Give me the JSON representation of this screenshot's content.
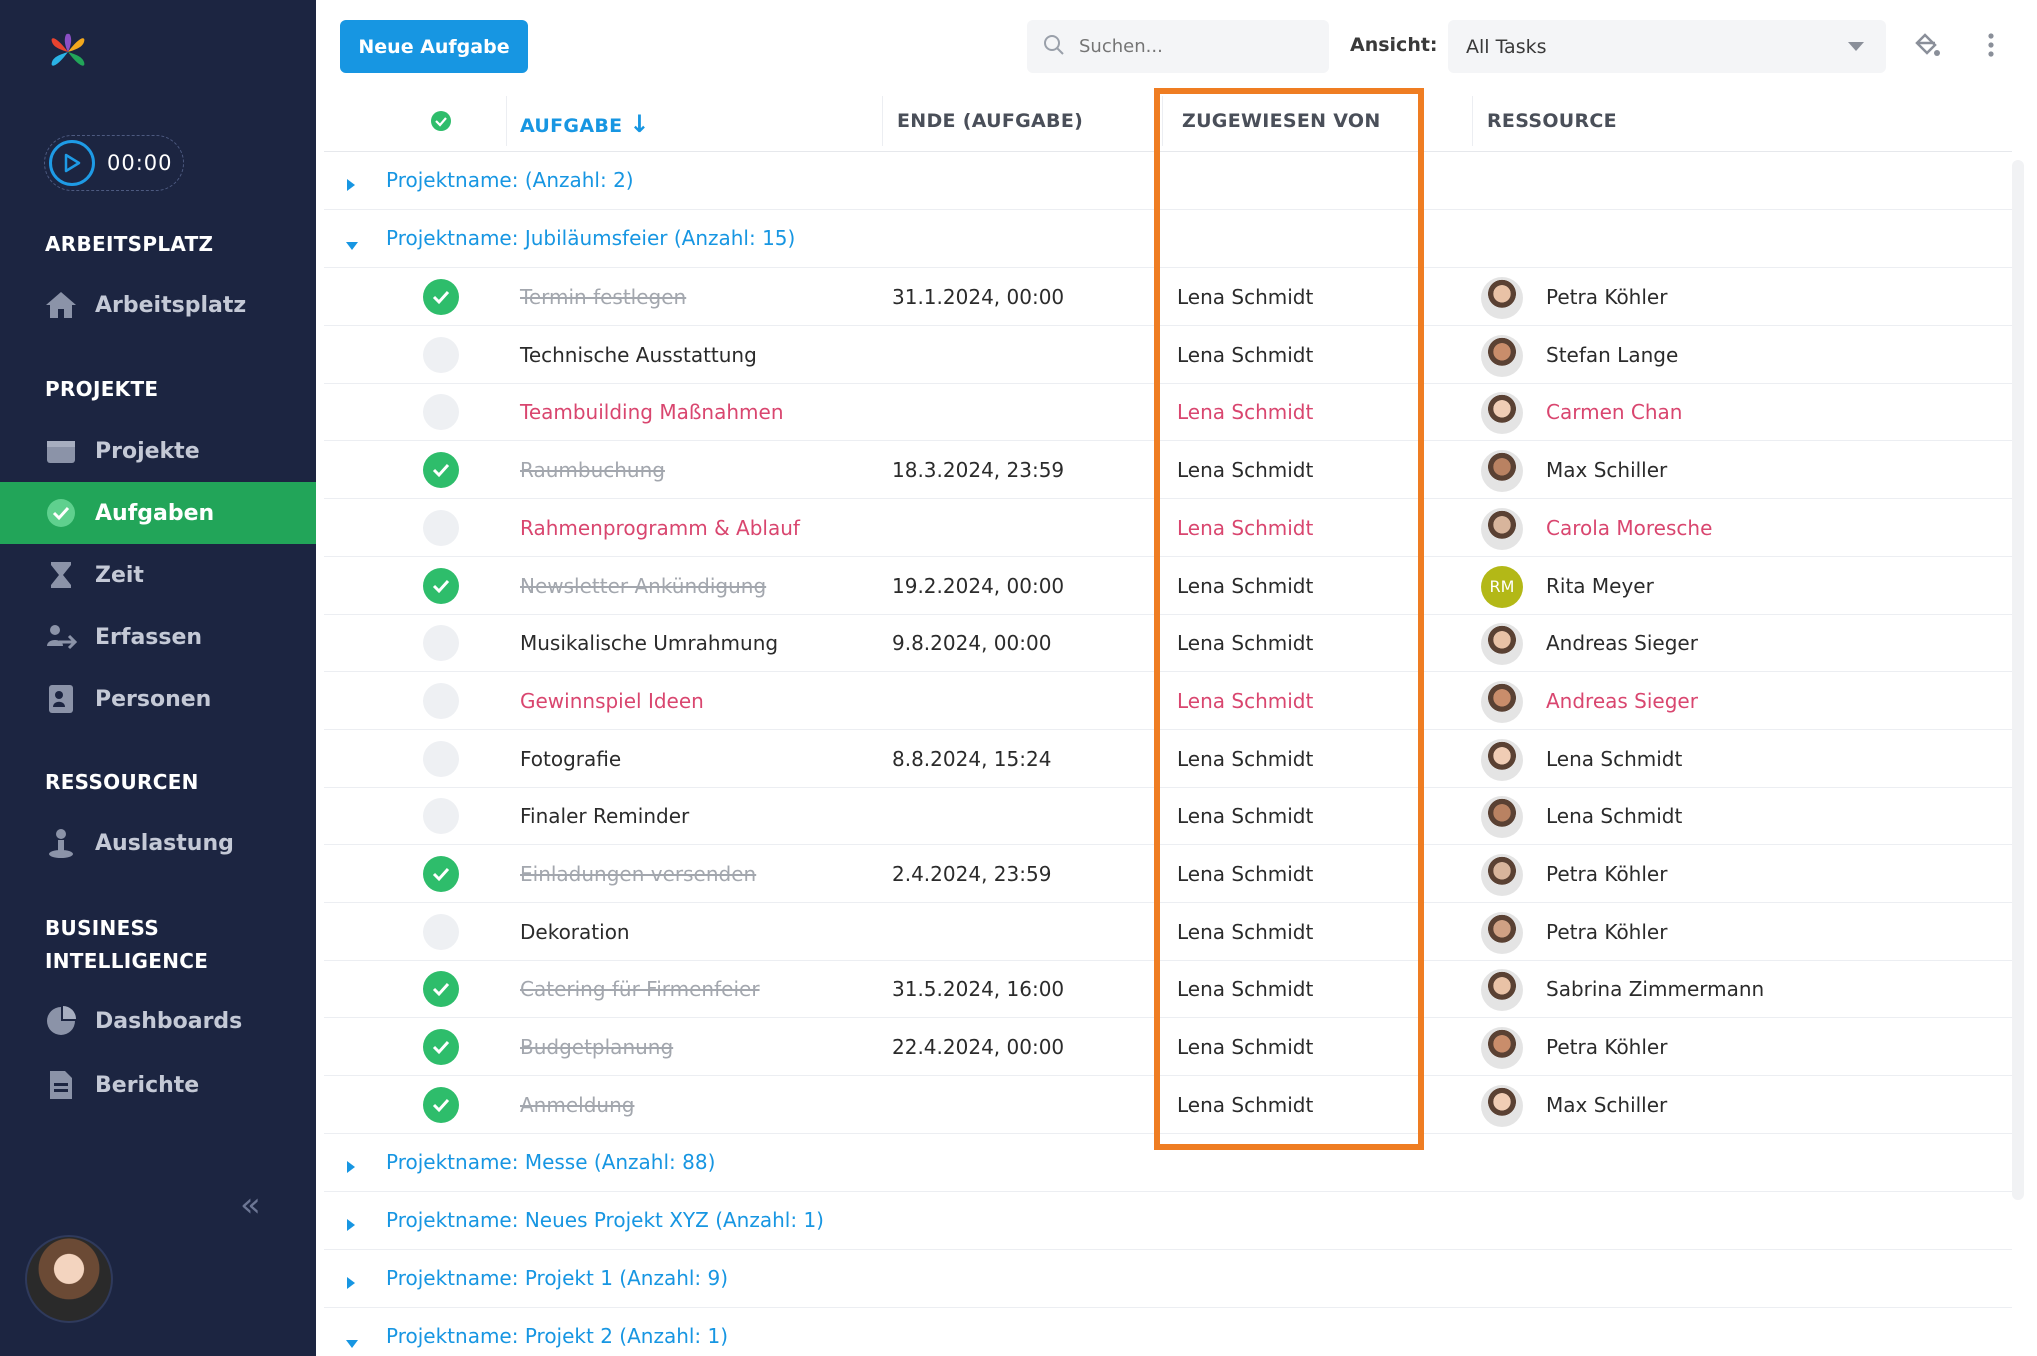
{
  "app": {
    "timer": "00:00",
    "new_task_label": "Neue Aufgabe",
    "search_placeholder": "Suchen...",
    "view_label": "Ansicht:",
    "view_value": "All Tasks",
    "accent_color": "#1796e2",
    "highlight_color": "#ef7d22"
  },
  "sidebar": {
    "sections": {
      "arbeitsplatz": "ARBEITSPLATZ",
      "projekte": "PROJEKTE",
      "ressourcen": "RESSOURCEN",
      "bi_line1": "BUSINESS",
      "bi_line2": "INTELLIGENCE"
    },
    "items": {
      "arbeitsplatz": "Arbeitsplatz",
      "projekte": "Projekte",
      "aufgaben": "Aufgaben",
      "zeit": "Zeit",
      "erfassen": "Erfassen",
      "personen": "Personen",
      "auslastung": "Auslastung",
      "dashboards": "Dashboards",
      "berichte": "Berichte"
    },
    "collapse": "«"
  },
  "table": {
    "headers": {
      "task": "AUFGABE",
      "sort_arrow": "↓",
      "end": "ENDE (AUFGABE)",
      "assigned_by": "ZUGEWIESEN VON",
      "resource": "RESSOURCE"
    },
    "groups": {
      "g0": "Projektname: (Anzahl: 2)",
      "g1": "Projektname: Jubiläumsfeier (Anzahl: 15)",
      "g2": "Projektname: Messe (Anzahl: 88)",
      "g3": "Projektname: Neues Projekt XYZ (Anzahl: 1)",
      "g4": "Projektname: Projekt 1 (Anzahl: 9)",
      "g5": "Projektname: Projekt 2 (Anzahl: 1)"
    },
    "rows": [
      {
        "task": "Termin festlegen",
        "end": "31.1.2024, 00:00",
        "by": "Lena Schmidt",
        "resource": "Petra Köhler"
      },
      {
        "task": "Technische Ausstattung",
        "end": "",
        "by": "Lena Schmidt",
        "resource": "Stefan Lange"
      },
      {
        "task": "Teambuilding Maßnahmen",
        "end": "",
        "by": "Lena Schmidt",
        "resource": "Carmen Chan"
      },
      {
        "task": "Raumbuchung",
        "end": "18.3.2024, 23:59",
        "by": "Lena Schmidt",
        "resource": "Max Schiller"
      },
      {
        "task": "Rahmenprogramm & Ablauf",
        "end": "",
        "by": "Lena Schmidt",
        "resource": "Carola Moresche"
      },
      {
        "task": "Newsletter Ankündigung",
        "end": "19.2.2024, 00:00",
        "by": "Lena Schmidt",
        "resource": "Rita Meyer",
        "initials": "RM"
      },
      {
        "task": "Musikalische Umrahmung",
        "end": "9.8.2024, 00:00",
        "by": "Lena Schmidt",
        "resource": "Andreas Sieger"
      },
      {
        "task": "Gewinnspiel Ideen",
        "end": "",
        "by": "Lena Schmidt",
        "resource": "Andreas Sieger"
      },
      {
        "task": "Fotografie",
        "end": "8.8.2024, 15:24",
        "by": "Lena Schmidt",
        "resource": "Lena Schmidt"
      },
      {
        "task": "Finaler Reminder",
        "end": "",
        "by": "Lena Schmidt",
        "resource": "Lena Schmidt"
      },
      {
        "task": "Einladungen versenden",
        "end": "2.4.2024, 23:59",
        "by": "Lena Schmidt",
        "resource": "Petra Köhler"
      },
      {
        "task": "Dekoration",
        "end": "",
        "by": "Lena Schmidt",
        "resource": "Petra Köhler"
      },
      {
        "task": "Catering für Firmenfeier",
        "end": "31.5.2024, 16:00",
        "by": "Lena Schmidt",
        "resource": "Sabrina Zimmermann"
      },
      {
        "task": "Budgetplanung",
        "end": "22.4.2024, 00:00",
        "by": "Lena Schmidt",
        "resource": "Petra Köhler"
      },
      {
        "task": "Anmeldung",
        "end": "",
        "by": "Lena Schmidt",
        "resource": "Max Schiller"
      }
    ]
  }
}
